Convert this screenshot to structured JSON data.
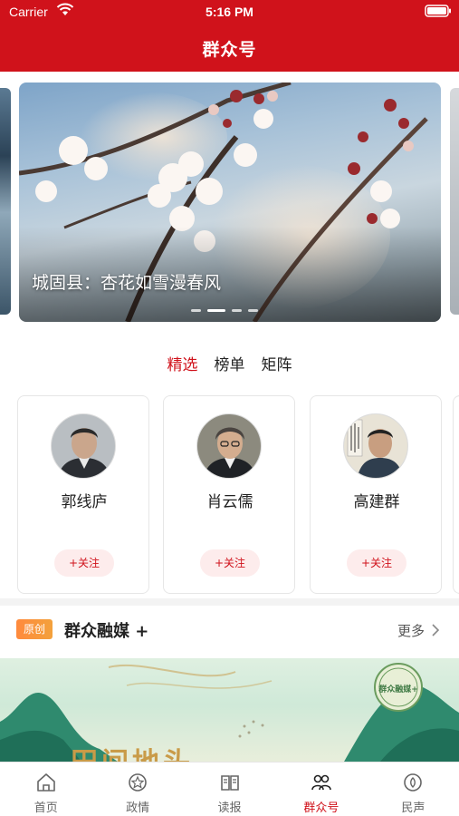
{
  "status_bar": {
    "carrier": "Carrier",
    "time": "5:16 PM"
  },
  "header": {
    "title": "群众号"
  },
  "carousel": {
    "caption": "城固县：杏花如雪漫春风",
    "slide_count": 4,
    "active_index": 1
  },
  "tabs": [
    {
      "label": "精选",
      "active": true
    },
    {
      "label": "榜单",
      "active": false
    },
    {
      "label": "矩阵",
      "active": false
    }
  ],
  "accounts": [
    {
      "name": "郭线庐",
      "follow_label": "+关注"
    },
    {
      "name": "肖云儒",
      "follow_label": "+关注"
    },
    {
      "name": "高建群",
      "follow_label": "+关注"
    }
  ],
  "section": {
    "badge": "原创",
    "title": "群众融媒 +",
    "more_label": "更多"
  },
  "banner": {
    "headline": "田间地头",
    "seal_text": "群众融媒+"
  },
  "bottom_nav": [
    {
      "label": "首页",
      "icon": "home-icon",
      "active": false
    },
    {
      "label": "政情",
      "icon": "government-icon",
      "active": false
    },
    {
      "label": "读报",
      "icon": "newspaper-icon",
      "active": false
    },
    {
      "label": "群众号",
      "icon": "people-icon",
      "active": true
    },
    {
      "label": "民声",
      "icon": "voice-icon",
      "active": false
    }
  ],
  "colors": {
    "brand_red": "#d0121b",
    "follow_bg": "#fdecec",
    "badge_orange": "#ff8a3d"
  }
}
